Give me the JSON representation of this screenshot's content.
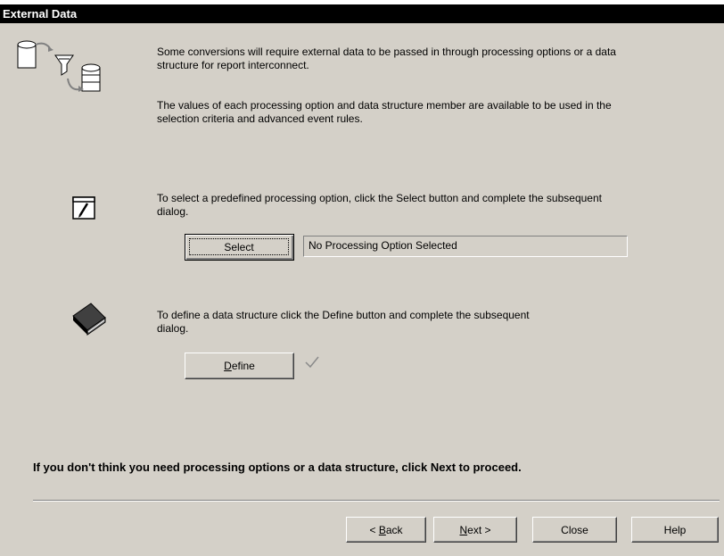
{
  "window": {
    "title": "External Data"
  },
  "intro": {
    "line1": "Some conversions will require external data to be passed in through processing options or a data",
    "line2": "structure for report interconnect.",
    "line3": "The values of each processing option and data structure member are available to be used in the",
    "line4": "selection criteria and advanced event rules."
  },
  "processing": {
    "line1": "To select a predefined processing option, click the Select button and complete the subsequent",
    "line2": "dialog.",
    "select_label": "Select",
    "status_text": "No Processing Option Selected"
  },
  "datastructure": {
    "line1": "To define a data structure click the Define button and complete the subsequent",
    "line2": "dialog.",
    "define_mnemonic": "D",
    "define_rest": "efine"
  },
  "hint": "If you don't think you need processing options or a data structure, click Next to proceed.",
  "footer": {
    "back_prefix": "< ",
    "back_mnemonic": "B",
    "back_rest": "ack",
    "next_mnemonic": "N",
    "next_rest": "ext >",
    "close_label": "Close",
    "help_label": "Help"
  },
  "icons": {
    "header": "data-filter-icon",
    "processing": "notepad-pencil-icon",
    "datastructure": "book-icon",
    "define_status": "checkmark-icon"
  },
  "colors": {
    "panel": "#d4d0c8",
    "titlebar": "#000000",
    "title_text": "#ffffff"
  }
}
